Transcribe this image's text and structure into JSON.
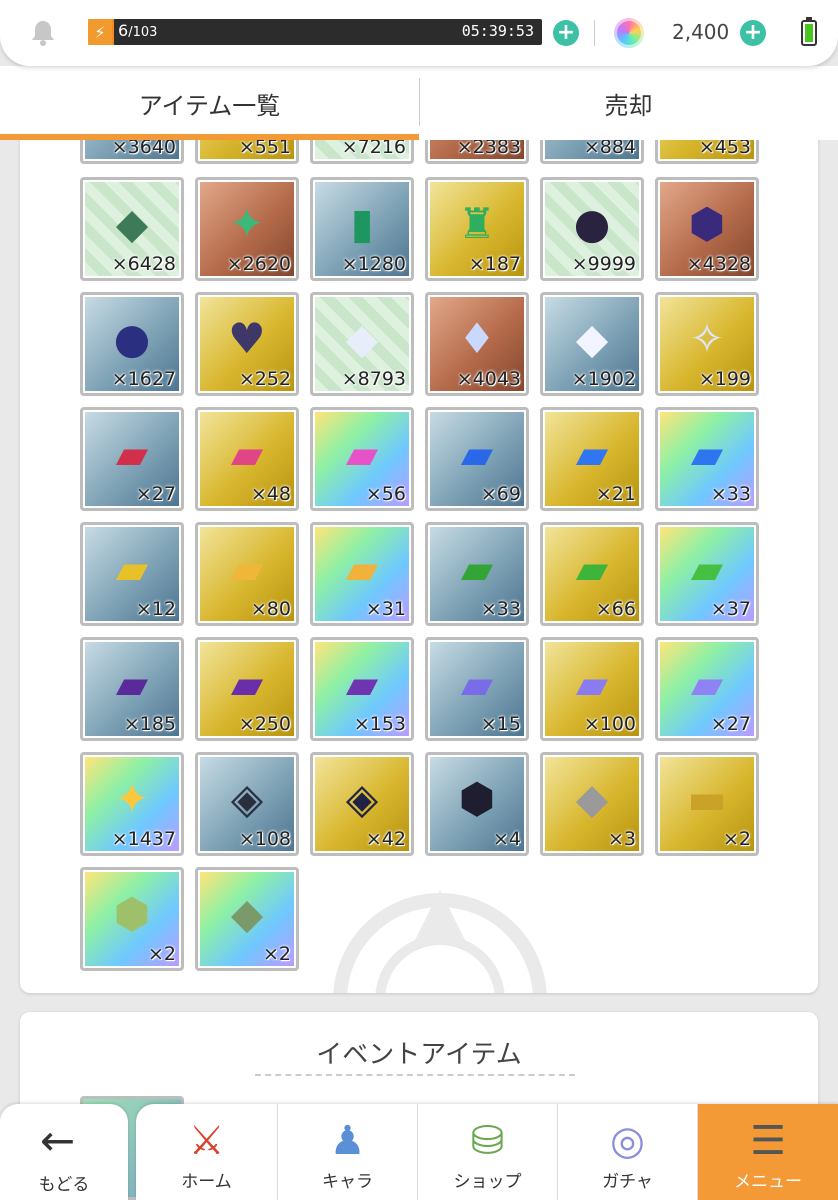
{
  "status": {
    "stamina_current": "6",
    "stamina_max": "/103",
    "stamina_fraction": 0.058,
    "timer": "05:39:53",
    "currency": "2,400",
    "stamina_add": "+",
    "currency_add": "+"
  },
  "tabs": [
    {
      "label": "アイテム一覧",
      "active": true
    },
    {
      "label": "売却",
      "active": false
    }
  ],
  "top_row_partial": [
    "×3640",
    "×551",
    "×7216",
    "×2383",
    "×884",
    "×453"
  ],
  "items": [
    {
      "qty": "×6428",
      "bg": "green",
      "icon": "◆",
      "color": "#3d7a57"
    },
    {
      "qty": "×2620",
      "bg": "bronze",
      "icon": "✦",
      "color": "#3bb87a"
    },
    {
      "qty": "×1280",
      "bg": "blue",
      "icon": "▮",
      "color": "#1e9660"
    },
    {
      "qty": "×187",
      "bg": "gold",
      "icon": "♜",
      "color": "#2fae60"
    },
    {
      "qty": "×9999",
      "bg": "green",
      "icon": "●",
      "color": "#2a2340"
    },
    {
      "qty": "×4328",
      "bg": "bronze",
      "icon": "⬢",
      "color": "#3a2a7c"
    },
    {
      "qty": "×1627",
      "bg": "blue",
      "icon": "●",
      "color": "#2b2f80"
    },
    {
      "qty": "×252",
      "bg": "gold",
      "icon": "♥",
      "color": "#3e3868"
    },
    {
      "qty": "×8793",
      "bg": "green",
      "icon": "◆",
      "color": "#e7eef9"
    },
    {
      "qty": "×4043",
      "bg": "bronze",
      "icon": "♦",
      "color": "#c9d8ff"
    },
    {
      "qty": "×1902",
      "bg": "blue",
      "icon": "◆",
      "color": "#f2f5ff"
    },
    {
      "qty": "×199",
      "bg": "gold",
      "icon": "✧",
      "color": "#dde7ff"
    },
    {
      "qty": "×27",
      "bg": "blue",
      "icon": "▰",
      "color": "#d0304a"
    },
    {
      "qty": "×48",
      "bg": "gold",
      "icon": "▰",
      "color": "#e04586"
    },
    {
      "qty": "×56",
      "bg": "rainbow",
      "icon": "▰",
      "color": "#e852c8"
    },
    {
      "qty": "×69",
      "bg": "blue",
      "icon": "▰",
      "color": "#2a68e8"
    },
    {
      "qty": "×21",
      "bg": "gold",
      "icon": "▰",
      "color": "#2f76f0"
    },
    {
      "qty": "×33",
      "bg": "rainbow",
      "icon": "▰",
      "color": "#2d76f0"
    },
    {
      "qty": "×12",
      "bg": "blue",
      "icon": "▰",
      "color": "#e8c12a"
    },
    {
      "qty": "×80",
      "bg": "gold",
      "icon": "▰",
      "color": "#f0b63a"
    },
    {
      "qty": "×31",
      "bg": "rainbow",
      "icon": "▰",
      "color": "#f0b23a"
    },
    {
      "qty": "×33",
      "bg": "blue",
      "icon": "▰",
      "color": "#33a537"
    },
    {
      "qty": "×66",
      "bg": "gold",
      "icon": "▰",
      "color": "#3fb43a"
    },
    {
      "qty": "×37",
      "bg": "rainbow",
      "icon": "▰",
      "color": "#45c043"
    },
    {
      "qty": "×185",
      "bg": "blue",
      "icon": "▰",
      "color": "#5a2a9a"
    },
    {
      "qty": "×250",
      "bg": "gold",
      "icon": "▰",
      "color": "#6a2fa8"
    },
    {
      "qty": "×153",
      "bg": "rainbow",
      "icon": "▰",
      "color": "#6f35b0"
    },
    {
      "qty": "×15",
      "bg": "blue",
      "icon": "▰",
      "color": "#7a6ce8"
    },
    {
      "qty": "×100",
      "bg": "gold",
      "icon": "▰",
      "color": "#8a7cf0"
    },
    {
      "qty": "×27",
      "bg": "rainbow",
      "icon": "▰",
      "color": "#8f82f4"
    },
    {
      "qty": "×1437",
      "bg": "rainbow",
      "icon": "✦",
      "color": "#ffc83a"
    },
    {
      "qty": "×108",
      "bg": "blue",
      "icon": "◈",
      "color": "#2a2f40"
    },
    {
      "qty": "×42",
      "bg": "gold",
      "icon": "◈",
      "color": "#1f2344"
    },
    {
      "qty": "×4",
      "bg": "blue",
      "icon": "⬢",
      "color": "#1e1e30"
    },
    {
      "qty": "×3",
      "bg": "gold",
      "icon": "◆",
      "color": "#9a9a9a"
    },
    {
      "qty": "×2",
      "bg": "gold",
      "icon": "▬",
      "color": "#c9a227"
    },
    {
      "qty": "×2",
      "bg": "rainbow",
      "icon": "⬢",
      "color": "#9fc06a"
    },
    {
      "qty": "×2",
      "bg": "rainbow",
      "icon": "◆",
      "color": "#7a9a6a"
    }
  ],
  "event": {
    "title": "イベントアイテム"
  },
  "nav": {
    "back": "もどる",
    "items": [
      {
        "label": "ホーム",
        "icon": "home-icon",
        "glyph": "⚔",
        "color": "#d8432f"
      },
      {
        "label": "キャラ",
        "icon": "character-icon",
        "glyph": "♟",
        "color": "#5b8fd6"
      },
      {
        "label": "ショップ",
        "icon": "shop-icon",
        "glyph": "⛁",
        "color": "#6aa84f"
      },
      {
        "label": "ガチャ",
        "icon": "gacha-icon",
        "glyph": "◎",
        "color": "#8a8fd8"
      },
      {
        "label": "メニュー",
        "icon": "menu-icon",
        "glyph": "☰",
        "color": "#555555",
        "active": true
      }
    ]
  }
}
